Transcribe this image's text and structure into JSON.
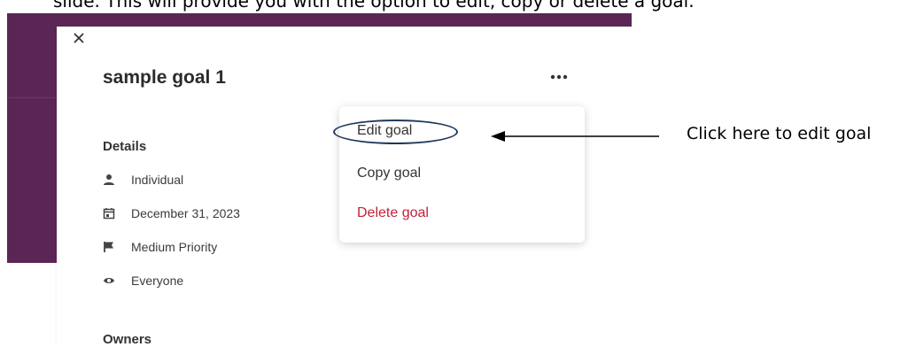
{
  "doc_text": "slide. This will provide you with the option to edit, copy or delete a goal.",
  "panel": {
    "close_icon": "close-icon",
    "title": "sample goal 1",
    "more_icon": "ellipsis-icon",
    "details_heading": "Details",
    "details": [
      {
        "icon": "person-icon",
        "label": "Individual"
      },
      {
        "icon": "calendar-icon",
        "label": "December 31, 2023"
      },
      {
        "icon": "flag-icon",
        "label": "Medium Priority"
      },
      {
        "icon": "eye-icon",
        "label": "Everyone"
      }
    ],
    "owners_heading": "Owners"
  },
  "menu": {
    "items": [
      "Edit goal",
      "Copy goal",
      "Delete goal"
    ],
    "delete_color": "#c0223a"
  },
  "annotation": {
    "callout": "Click here to edit goal"
  },
  "colors": {
    "band": "#5b2556",
    "arrow": "#000000",
    "oval": "#1f3a5a"
  }
}
